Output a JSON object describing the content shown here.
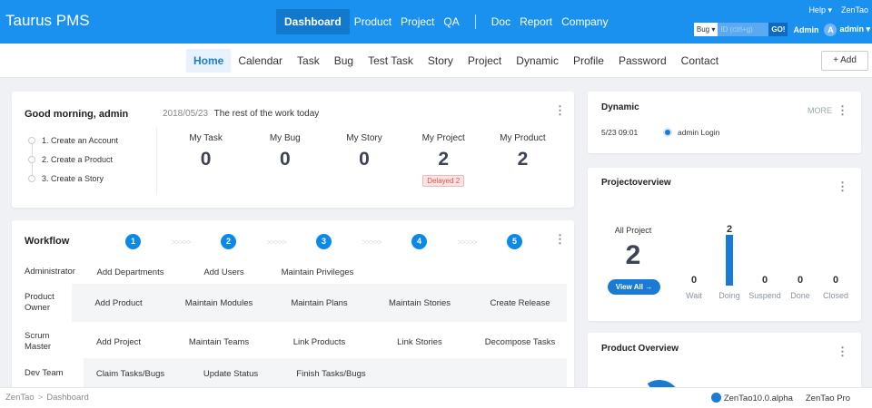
{
  "topbar": {
    "brand": "Taurus PMS",
    "nav": [
      "Dashboard",
      "Product",
      "Project",
      "QA"
    ],
    "nav2": [
      "Doc",
      "Report",
      "Company"
    ],
    "help": "Help ▾",
    "zentao": "ZenTao",
    "search": {
      "type": "Bug ▾",
      "placeholder": "ID (ctrl+g)",
      "go": "GO!"
    },
    "role": "Admin",
    "avatar_letter": "A",
    "user": "admin ▾",
    "color": "#1a91ee"
  },
  "subnav": {
    "items": [
      "Home",
      "Calendar",
      "Task",
      "Bug",
      "Test Task",
      "Story",
      "Project",
      "Dynamic",
      "Profile",
      "Password",
      "Contact"
    ],
    "add": "+ Add"
  },
  "welcome": {
    "greeting": "Good morning, admin",
    "date": "2018/05/23",
    "subtitle": "The rest of the work today",
    "steps": [
      "1. Create an Account",
      "2. Create a Product",
      "3. Create a Story"
    ],
    "stats": [
      {
        "label": "My Task",
        "value": "0"
      },
      {
        "label": "My Bug",
        "value": "0"
      },
      {
        "label": "My Story",
        "value": "0"
      },
      {
        "label": "My Project",
        "value": "2",
        "tag": "Delayed 2"
      },
      {
        "label": "My Product",
        "value": "2"
      }
    ]
  },
  "workflow": {
    "title": "Workflow",
    "steps": [
      "1",
      "2",
      "3",
      "4",
      "5"
    ],
    "arrow": ">>>>>",
    "rows": [
      {
        "role": "Administrator",
        "cells": [
          "Add Departments",
          "Add Users",
          "Maintain Privileges"
        ]
      },
      {
        "role": "Product Owner",
        "cells": [
          "Add Product",
          "Maintain Modules",
          "Maintain Plans",
          "Maintain Stories",
          "Create Release"
        ]
      },
      {
        "role": "Scrum Master",
        "cells": [
          "Add Project",
          "Maintain Teams",
          "Link Products",
          "Link Stories",
          "Decompose Tasks"
        ]
      },
      {
        "role": "Dev Team",
        "cells": [
          "Claim Tasks/Bugs",
          "Update Status",
          "Finish Tasks/Bugs"
        ]
      }
    ]
  },
  "dynamic": {
    "title": "Dynamic",
    "more": "MORE",
    "items": [
      {
        "time": "5/23 09:01",
        "text": "admin Login"
      }
    ]
  },
  "project_overview": {
    "title": "Projectoverview",
    "all_label": "All Project",
    "all_value": "2",
    "view_all": "View All →",
    "bars": [
      {
        "label": "Wait",
        "value": 0
      },
      {
        "label": "Doing",
        "value": 2
      },
      {
        "label": "Suspend",
        "value": 0
      },
      {
        "label": "Done",
        "value": 0
      },
      {
        "label": "Closed",
        "value": 0
      }
    ],
    "bar_color": "#1a7bd4"
  },
  "product_overview": {
    "title": "Product Overview"
  },
  "footer": {
    "crumbs": [
      "ZenTao",
      "Dashboard"
    ],
    "crumb_sep": ">",
    "version": "ZenTao10.0.alpha",
    "pro": "ZenTao Pro"
  }
}
